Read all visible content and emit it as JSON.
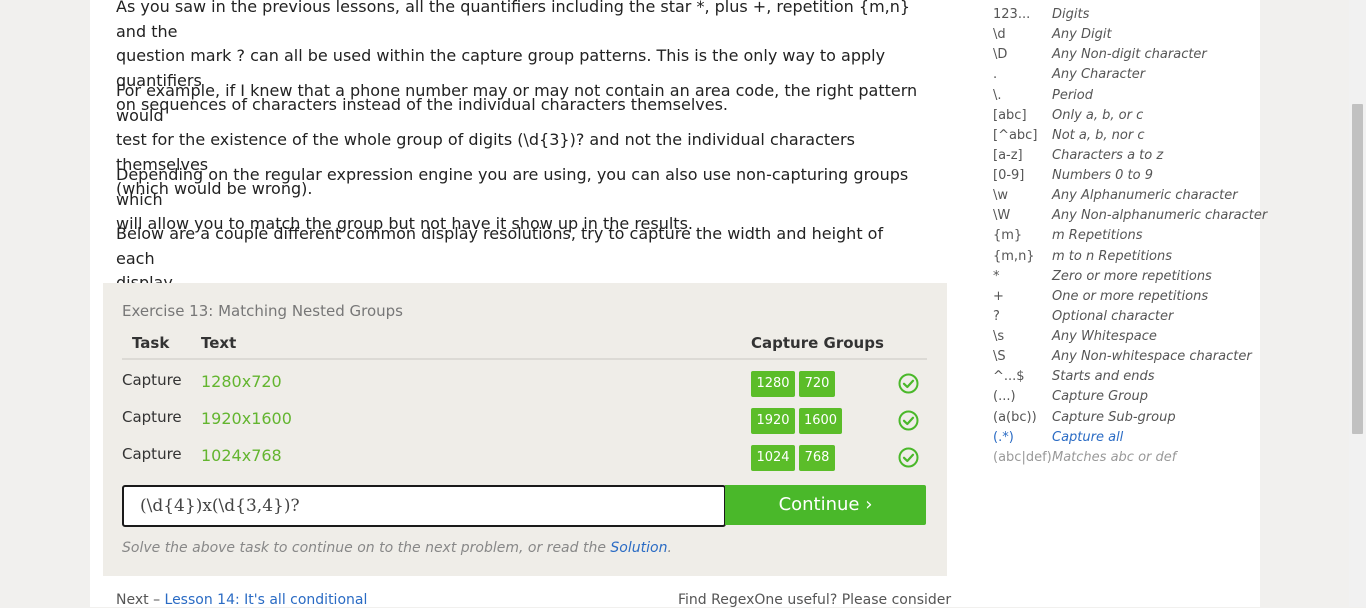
{
  "lesson": {
    "para1_line1": "As you saw in the previous lessons, all the quantifiers including the star *, plus +, repetition {m,n} and the",
    "para1_line2": "question mark ? can all be used within the capture group patterns. This is the only way to apply quantifiers",
    "para1_line3": "on sequences of characters instead of the individual characters themselves.",
    "para2_line1": "For example, if I knew that a phone number may or may not contain an area code, the right pattern would",
    "para2_line2": "test for the existence of the whole group of digits (\\d{3})? and not the individual characters themselves",
    "para2_line3": "(which would be wrong).",
    "para3_line1": "Depending on the regular expression engine you are using, you can also use non-capturing groups which",
    "para3_line2": "will allow you to match the group but not have it show up in the results.",
    "para4_line1": "Below are a couple different common display resolutions, try to capture the width and height of each",
    "para4_line2": "display."
  },
  "exercise": {
    "title": "Exercise 13: Matching Nested Groups",
    "col_task": "Task",
    "col_text": "Text",
    "col_groups": "Capture Groups",
    "rows": [
      {
        "task": "Capture",
        "text": "1280x720",
        "groups": [
          "1280",
          "720"
        ]
      },
      {
        "task": "Capture",
        "text": "1920x1600",
        "groups": [
          "1920",
          "1600"
        ]
      },
      {
        "task": "Capture",
        "text": "1024x768",
        "groups": [
          "1024",
          "768"
        ]
      }
    ],
    "input_value": "(\\d{4})x(\\d{3,4})?",
    "continue_label": "Continue ›",
    "hint_prefix": "Solve the above task to continue on to the next problem, or read the ",
    "hint_link": "Solution",
    "hint_suffix": "."
  },
  "footer": {
    "next_prefix": "Next – ",
    "next_link": "Lesson 14: It's all conditional",
    "support_text": "Find RegexOne useful? Please consider"
  },
  "cheatsheet": [
    {
      "sym": "123...",
      "desc": "Digits"
    },
    {
      "sym": "\\d",
      "desc": "Any Digit"
    },
    {
      "sym": "\\D",
      "desc": "Any Non-digit character"
    },
    {
      "sym": ".",
      "desc": "Any Character"
    },
    {
      "sym": "\\.",
      "desc": "Period"
    },
    {
      "sym": "[abc]",
      "desc": "Only a, b, or c"
    },
    {
      "sym": "[^abc]",
      "desc": "Not a, b, nor c"
    },
    {
      "sym": "[a-z]",
      "desc": "Characters a to z"
    },
    {
      "sym": "[0-9]",
      "desc": "Numbers 0 to 9"
    },
    {
      "sym": "\\w",
      "desc": "Any Alphanumeric character"
    },
    {
      "sym": "\\W",
      "desc": "Any Non-alphanumeric character"
    },
    {
      "sym": "{m}",
      "desc": "m Repetitions"
    },
    {
      "sym": "{m,n}",
      "desc": "m to n Repetitions"
    },
    {
      "sym": "*",
      "desc": "Zero or more repetitions"
    },
    {
      "sym": "+",
      "desc": "One or more repetitions"
    },
    {
      "sym": "?",
      "desc": "Optional character"
    },
    {
      "sym": "\\s",
      "desc": "Any Whitespace"
    },
    {
      "sym": "\\S",
      "desc": "Any Non-whitespace character"
    },
    {
      "sym": "^...$",
      "desc": "Starts and ends"
    },
    {
      "sym": "(...)",
      "desc": "Capture Group"
    },
    {
      "sym": "(a(bc))",
      "desc": "Capture Sub-group"
    },
    {
      "sym": "(.*)",
      "desc": "Capture all"
    },
    {
      "sym": "(abc|def)",
      "desc": "Matches abc or def"
    }
  ],
  "colors": {
    "accent_green": "#5bbd29",
    "link_blue": "#2a6bc4"
  }
}
